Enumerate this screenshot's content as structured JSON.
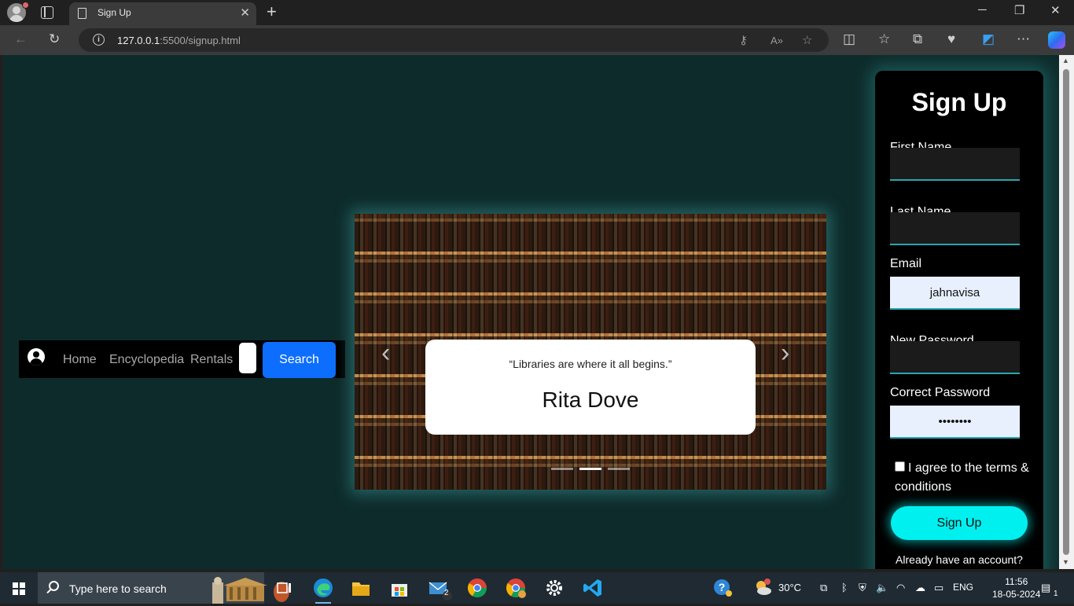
{
  "browser": {
    "tab_title": "Sign Up",
    "url_host": "127.0.0.1",
    "url_rest": ":5500/signup.html",
    "info_glyph": "i"
  },
  "navbar": {
    "links": [
      "Home",
      "Encyclopedia",
      "Rentals"
    ],
    "search_label": "Search"
  },
  "carousel": {
    "quote": "“Libraries are where it all begins.”",
    "author": "Rita Dove",
    "active_slide": 2
  },
  "form": {
    "title": "Sign Up",
    "first_name_label": "First Name",
    "first_name_value": "",
    "last_name_label": "Last Name",
    "last_name_value": "",
    "email_label": "Email",
    "email_value": "jahnavisa",
    "new_password_label": "New Password",
    "new_password_value": "",
    "correct_password_label": "Correct Password",
    "correct_password_value": "••••••••",
    "agree_text": "I agree to the terms & conditions",
    "submit_label": "Sign Up",
    "already_text": "Already have an account?"
  },
  "taskbar": {
    "search_placeholder": "Type here to search",
    "temperature": "30°C",
    "language": "ENG",
    "time": "11:56",
    "date": "18-05-2024",
    "mail_badge": "2",
    "notif_count": "1"
  },
  "colors": {
    "page_bg": "#0e2b2b",
    "search_button": "#0d6efd",
    "signup_button": "#00f0f0",
    "input_underline": "#2aa6ad"
  }
}
